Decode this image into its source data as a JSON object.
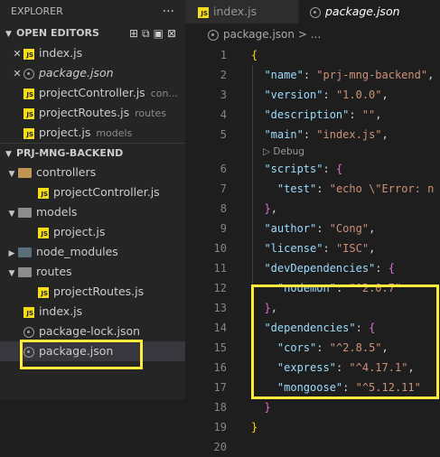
{
  "explorer": {
    "title": "EXPLORER",
    "more": "···",
    "open_editors": {
      "title": "OPEN EDITORS",
      "items": [
        {
          "name": "index.js",
          "desc": "",
          "icon": "js-file-icon"
        },
        {
          "name": "package.json",
          "desc": "",
          "icon": "package-json-icon"
        },
        {
          "name": "projectController.js",
          "desc": "con...",
          "icon": "js-file-icon"
        },
        {
          "name": "projectRoutes.js",
          "desc": "routes",
          "icon": "js-file-icon"
        },
        {
          "name": "project.js",
          "desc": "models",
          "icon": "js-file-icon"
        }
      ]
    },
    "workspace": {
      "title": "PRJ-MNG-BACKEND",
      "items": [
        {
          "name": "controllers"
        },
        {
          "name": "projectController.js"
        },
        {
          "name": "models"
        },
        {
          "name": "project.js"
        },
        {
          "name": "node_modules"
        },
        {
          "name": "routes"
        },
        {
          "name": "projectRoutes.js"
        },
        {
          "name": "index.js"
        },
        {
          "name": "package-lock.json"
        },
        {
          "name": "package.json"
        }
      ]
    }
  },
  "tabs": [
    {
      "label": "index.js"
    },
    {
      "label": "package.json"
    }
  ],
  "breadcrumb": {
    "file": "package.json",
    "sep": ">",
    "rest": "..."
  },
  "editor": {
    "codelens": "▷ Debug",
    "lines": {
      "l1": "1",
      "l2": "2",
      "l3": "3",
      "l4": "4",
      "l5": "5",
      "l6": "6",
      "l7": "7",
      "l8": "8",
      "l9": "9",
      "l10": "10",
      "l11": "11",
      "l12": "12",
      "l13": "13",
      "l14": "14",
      "l15": "15",
      "l16": "16",
      "l17": "17",
      "l18": "18",
      "l19": "19",
      "l20": "20"
    },
    "code": {
      "name_key": "\"name\"",
      "name_val": "\"prj-mng-backend\"",
      "version_key": "\"version\"",
      "version_val": "\"1.0.0\"",
      "description_key": "\"description\"",
      "description_val": "\"\"",
      "main_key": "\"main\"",
      "main_val": "\"index.js\"",
      "scripts_key": "\"scripts\"",
      "test_key": "\"test\"",
      "test_val": "\"echo \\\"Error: n",
      "author_key": "\"author\"",
      "author_val": "\"Cong\"",
      "license_key": "\"license\"",
      "license_val": "\"ISC\"",
      "devdeps_key": "\"devDependencies\"",
      "nodemon_key": "\"nodemon\"",
      "nodemon_val": "\"^2.0.7\"",
      "deps_key": "\"dependencies\"",
      "cors_key": "\"cors\"",
      "cors_val": "\"^2.8.5\"",
      "express_key": "\"express\"",
      "express_val": "\"^4.17.1\"",
      "mongoose_key": "\"mongoose\"",
      "mongoose_val": "\"^5.12.11\""
    }
  },
  "colors": {
    "highlight": "#ffeb3b",
    "js_icon": "#f5de19",
    "folder": "#c09553"
  }
}
